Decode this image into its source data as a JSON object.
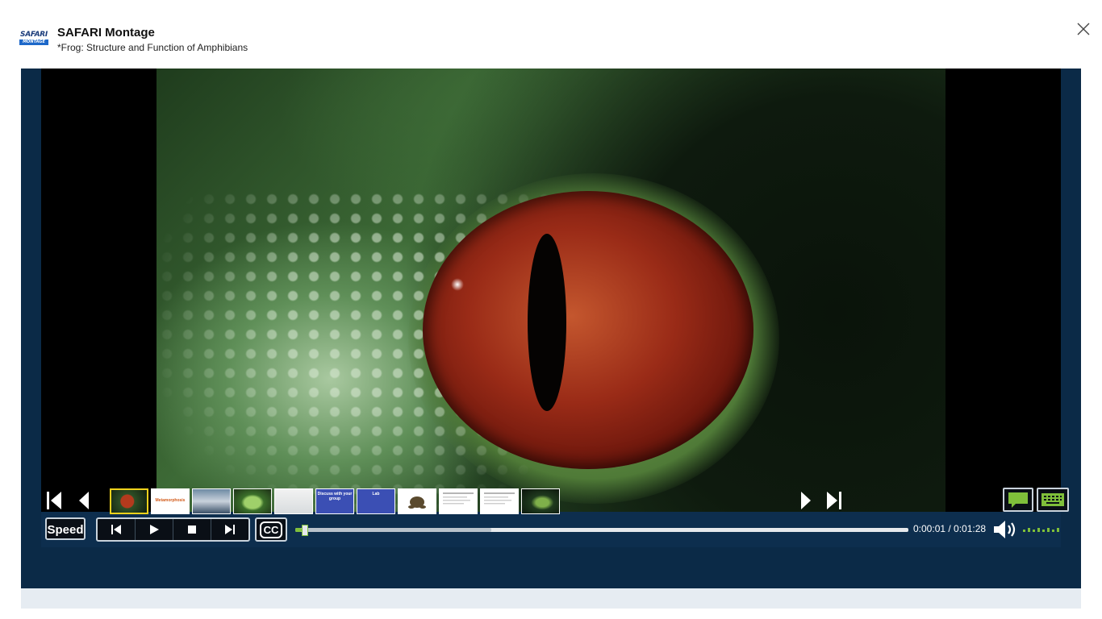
{
  "app": {
    "logo_text_top": "SAFARI",
    "logo_text_bottom": "MONTAGE",
    "title": "SAFARI Montage",
    "subtitle": "*Frog: Structure and Function of Amphibians"
  },
  "icons": {
    "close": "close-icon",
    "volume": "speaker-icon",
    "chat": "chat-bubble-icon",
    "keyboard": "keyboard-icon"
  },
  "controls": {
    "speed_label": "Speed",
    "cc_label": "CC",
    "time_display": "0:00:01 / 0:01:28",
    "progress_fraction": 0.011,
    "buffered_fraction": 0.32,
    "volume_bars": 8
  },
  "thumbnails": [
    {
      "label": "",
      "kind": "frog-eye",
      "active": true
    },
    {
      "label": "Metamorphosis",
      "kind": "title-card",
      "active": false
    },
    {
      "label": "",
      "kind": "presenter",
      "active": false
    },
    {
      "label": "",
      "kind": "frog-green",
      "active": false
    },
    {
      "label": "",
      "kind": "room",
      "active": false
    },
    {
      "label": "Discuss with your group",
      "kind": "blue-card",
      "active": false
    },
    {
      "label": "Lab",
      "kind": "blue-card-lab",
      "active": false
    },
    {
      "label": "",
      "kind": "frog-drawing",
      "active": false
    },
    {
      "label": "",
      "kind": "document",
      "active": false
    },
    {
      "label": "",
      "kind": "document",
      "active": false
    },
    {
      "label": "",
      "kind": "frog-dark",
      "active": false
    }
  ],
  "colors": {
    "frame_bg": "#0b2a47",
    "progress": "#7fbf3a",
    "active_thumb_border": "#f0d21c"
  }
}
